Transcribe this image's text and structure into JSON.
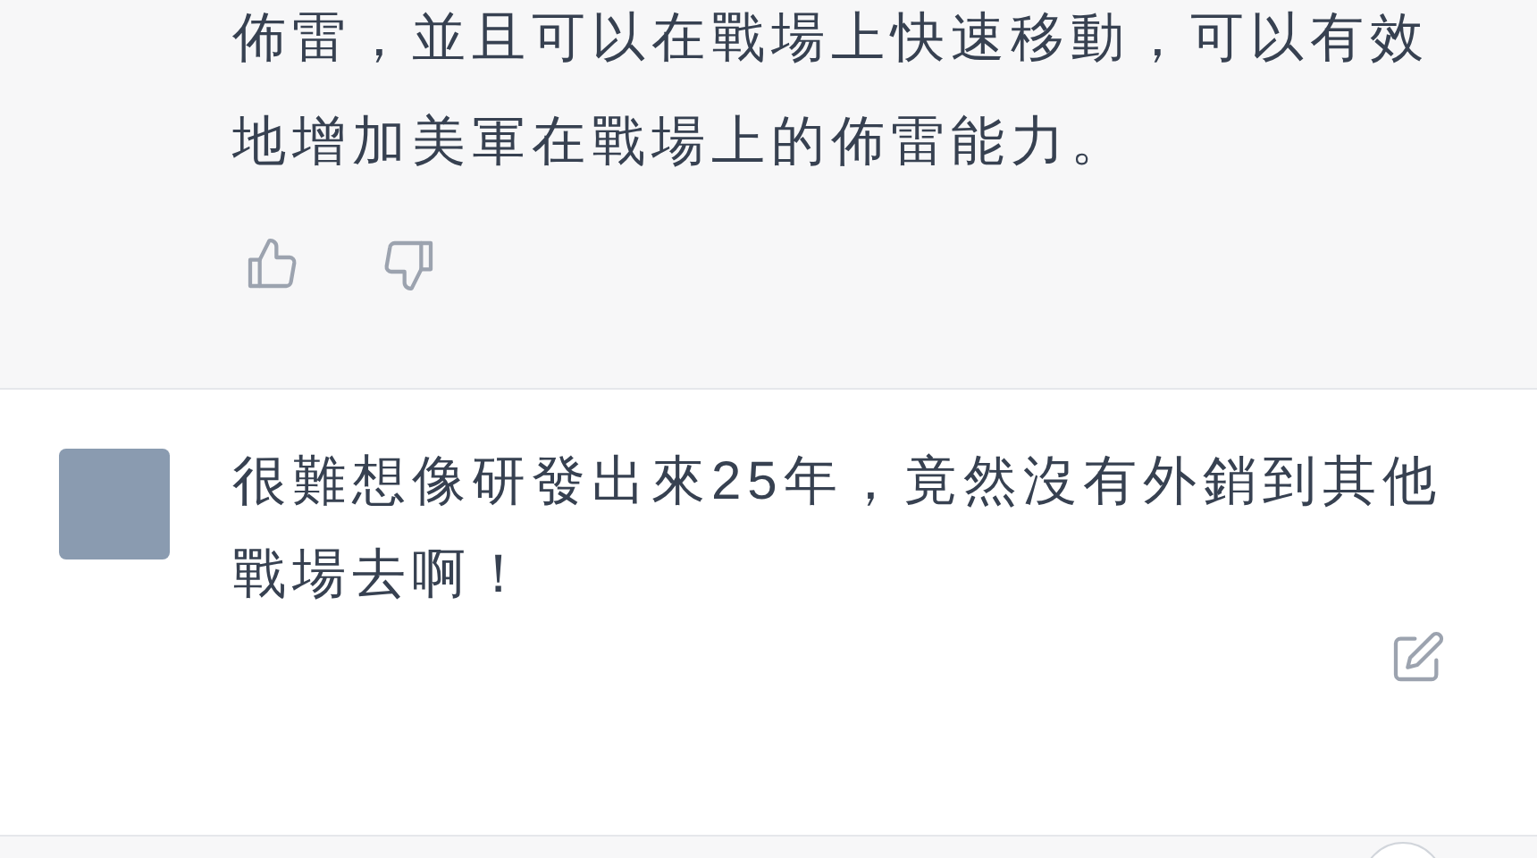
{
  "messages": [
    {
      "kind": "reply",
      "text": "佈雷，並且可以在戰場上快速移動，可以有效地增加美軍在戰場上的佈雷能力。"
    },
    {
      "kind": "prompt",
      "text": "很難想像研發出來25年，竟然沒有外銷到其他戰場去啊！"
    }
  ]
}
